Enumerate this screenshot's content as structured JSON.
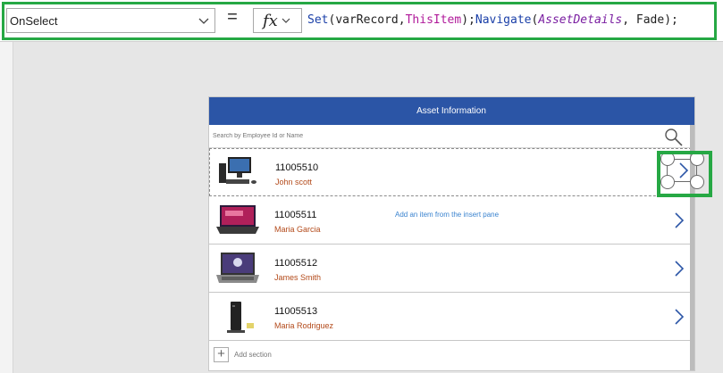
{
  "formula_bar": {
    "property": "OnSelect",
    "equals": "=",
    "fx_label": "fx",
    "formula": {
      "set": "Set",
      "open1": "(",
      "var": "varRecord",
      "comma1": ",",
      "this_item": "ThisItem",
      "close1": ");",
      "navigate": "Navigate",
      "open2": "(",
      "screen": "AssetDetails",
      "comma2": ", ",
      "fade": "Fade",
      "close2": ");"
    }
  },
  "app": {
    "title": "Asset Information",
    "search_placeholder": "Search by Employee Id or Name",
    "insert_hint": "Add an item from the insert pane",
    "add_section_label": "Add section",
    "rows": [
      {
        "id": "11005510",
        "name": "John scott",
        "image": "desktop-computer"
      },
      {
        "id": "11005511",
        "name": "Maria Garcia",
        "image": "laptop"
      },
      {
        "id": "11005512",
        "name": "James Smith",
        "image": "laptop-hp"
      },
      {
        "id": "11005513",
        "name": "Maria Rodriguez",
        "image": "thin-client"
      }
    ]
  },
  "colors": {
    "header_blue": "#2b55a6",
    "highlight_green": "#26a844",
    "name_orange": "#b34a1a",
    "hint_blue": "#3a83cf"
  }
}
